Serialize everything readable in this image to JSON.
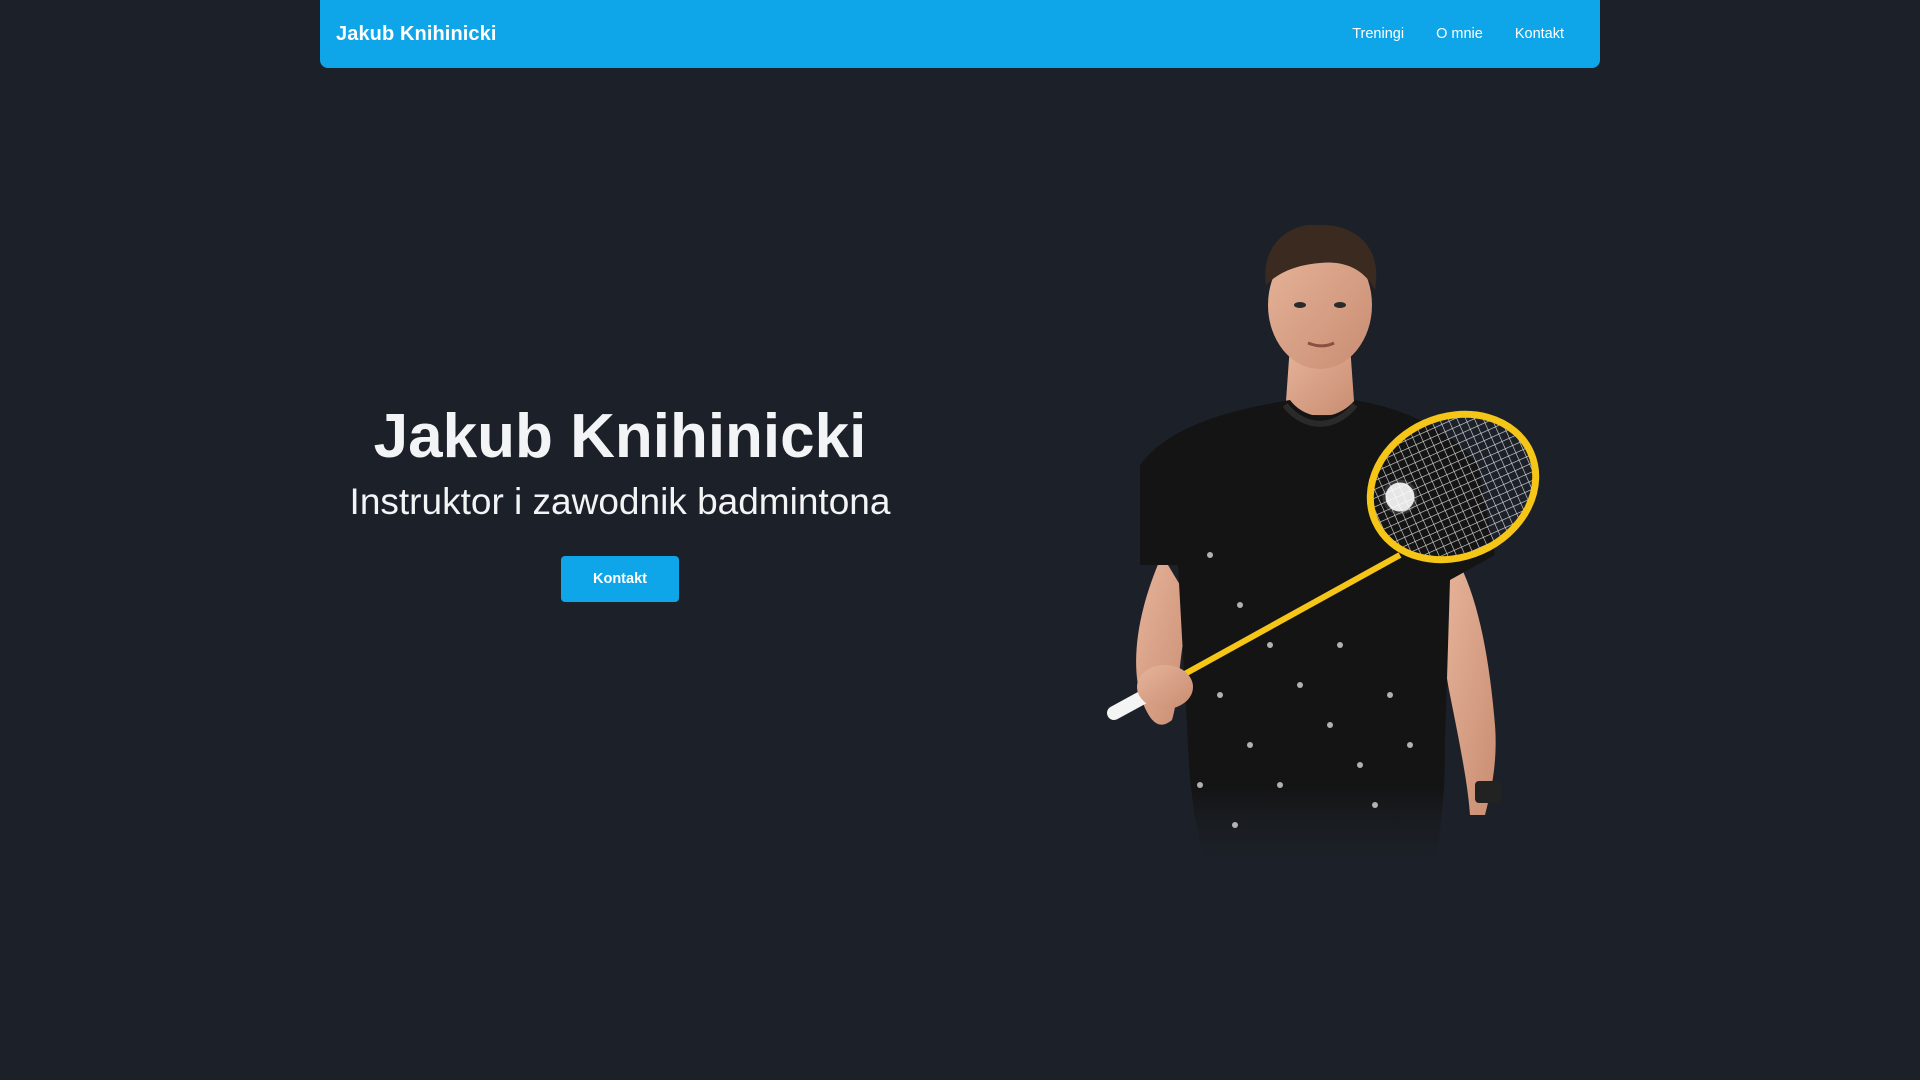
{
  "nav": {
    "brand": "Jakub Knihinicki",
    "links": [
      "Treningi",
      "O mnie",
      "Kontakt"
    ]
  },
  "hero": {
    "title": "Jakub Knihinicki",
    "subtitle": "Instruktor i zawodnik badmintona",
    "cta_label": "Kontakt"
  },
  "colors": {
    "background": "#1c2129",
    "accent": "#0ea5e9",
    "text": "#f3f4f6",
    "racket": "#f5c518"
  }
}
